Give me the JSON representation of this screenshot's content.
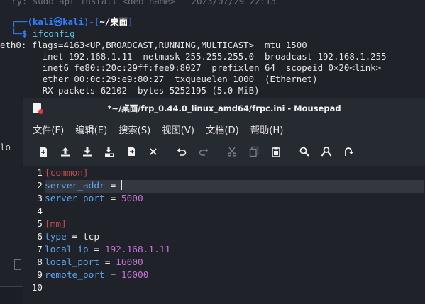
{
  "terminal": {
    "faded_top": "ry: sudo apt install <deb name>",
    "faded_date": "2023/07/29 22:13",
    "prompt_user": "kali",
    "prompt_at": "㉿",
    "prompt_host": "kali",
    "prompt_path": "~/桌面",
    "command": "ifconfig",
    "output": [
      "eth0: flags=4163<UP,BROADCAST,RUNNING,MULTICAST>  mtu 1500",
      "        inet 192.168.1.11  netmask 255.255.255.0  broadcast 192.168.1.255",
      "        inet6 fe80::20c:29ff:fee9:8027  prefixlen 64  scopeid 0×20<link>",
      "        ether 00:0c:29:e9:80:27  txqueuelen 1000  (Ethernet)",
      "        RX packets 62102  bytes 5252195 (5.0 MiB)"
    ],
    "fragment_lo": "lo"
  },
  "mousepad": {
    "title": "*~/桌面/frp_0.44.0_linux_amd64/frpc.ini - Mousepad",
    "menu": [
      "文件(F)",
      "编辑(E)",
      "搜索(S)",
      "视图(V)",
      "文档(D)",
      "帮助(H)"
    ],
    "toolbar": [
      {
        "name": "new-document-icon",
        "dim": false
      },
      {
        "name": "open-document-icon",
        "dim": false
      },
      {
        "name": "save-document-icon",
        "dim": false
      },
      {
        "name": "save-as-document-icon",
        "dim": false
      },
      {
        "name": "reload-document-icon",
        "dim": false
      },
      {
        "name": "close-document-icon",
        "dim": false
      },
      {
        "name": "undo-icon",
        "dim": false
      },
      {
        "name": "redo-icon",
        "dim": true
      },
      {
        "name": "cut-icon",
        "dim": true
      },
      {
        "name": "copy-icon",
        "dim": true
      },
      {
        "name": "paste-icon",
        "dim": false
      },
      {
        "name": "find-icon",
        "dim": false
      },
      {
        "name": "find-replace-icon",
        "dim": false
      },
      {
        "name": "go-to-line-icon",
        "dim": false
      }
    ],
    "lines": [
      {
        "n": "1",
        "parts": [
          {
            "t": "[common]",
            "c": "sec"
          }
        ]
      },
      {
        "n": "2",
        "parts": [
          {
            "t": "server_addr",
            "c": "key"
          },
          {
            "t": " = ",
            "c": "op"
          }
        ],
        "caret": true,
        "current": true
      },
      {
        "n": "3",
        "parts": [
          {
            "t": "server_port",
            "c": "key"
          },
          {
            "t": " = ",
            "c": "op"
          },
          {
            "t": "5000",
            "c": "num"
          }
        ]
      },
      {
        "n": "4",
        "parts": []
      },
      {
        "n": "5",
        "parts": [
          {
            "t": "[mm]",
            "c": "sec"
          }
        ]
      },
      {
        "n": "6",
        "parts": [
          {
            "t": "type",
            "c": "key"
          },
          {
            "t": " = ",
            "c": "op"
          },
          {
            "t": "tcp",
            "c": "plain"
          }
        ]
      },
      {
        "n": "7",
        "parts": [
          {
            "t": "local_ip",
            "c": "key"
          },
          {
            "t": " = ",
            "c": "op"
          },
          {
            "t": "192.168.1.11",
            "c": "ip"
          }
        ]
      },
      {
        "n": "8",
        "parts": [
          {
            "t": "local_port",
            "c": "key"
          },
          {
            "t": " = ",
            "c": "op"
          },
          {
            "t": "16000",
            "c": "num"
          }
        ]
      },
      {
        "n": "9",
        "parts": [
          {
            "t": "remote_port",
            "c": "key"
          },
          {
            "t": " = ",
            "c": "op"
          },
          {
            "t": "16000",
            "c": "num"
          }
        ]
      },
      {
        "n": "10",
        "parts": []
      }
    ]
  }
}
